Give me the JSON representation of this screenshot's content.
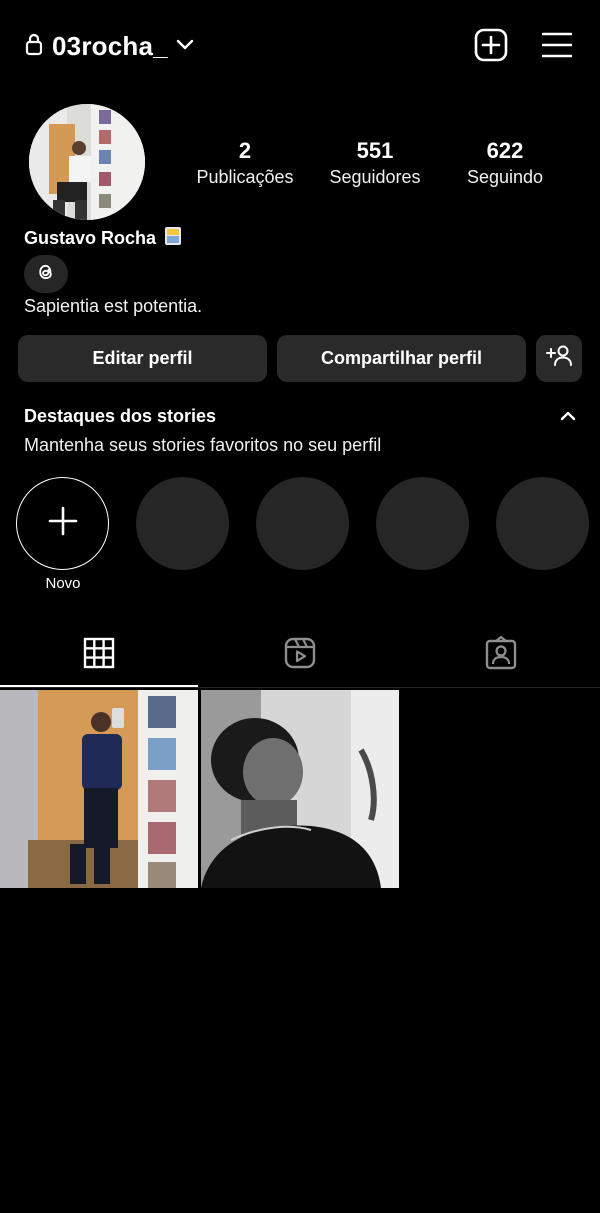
{
  "header": {
    "username": "03rocha_",
    "icons": [
      "lock-icon",
      "chevron-down-icon",
      "new-post-icon",
      "menu-icon"
    ]
  },
  "profile": {
    "name": "Gustavo Rocha",
    "bio": "Sapientia est potentia."
  },
  "stats": [
    {
      "value": "2",
      "label": "Publicações"
    },
    {
      "value": "551",
      "label": "Seguidores"
    },
    {
      "value": "622",
      "label": "Seguindo"
    }
  ],
  "actions": {
    "edit": "Editar perfil",
    "share": "Compartilhar perfil"
  },
  "highlights": {
    "title": "Destaques dos stories",
    "subtitle": "Mantenha seus stories favoritos no seu perfil",
    "new_label": "Novo"
  },
  "tabs": [
    "grid-icon",
    "reels-icon",
    "tagged-icon"
  ]
}
